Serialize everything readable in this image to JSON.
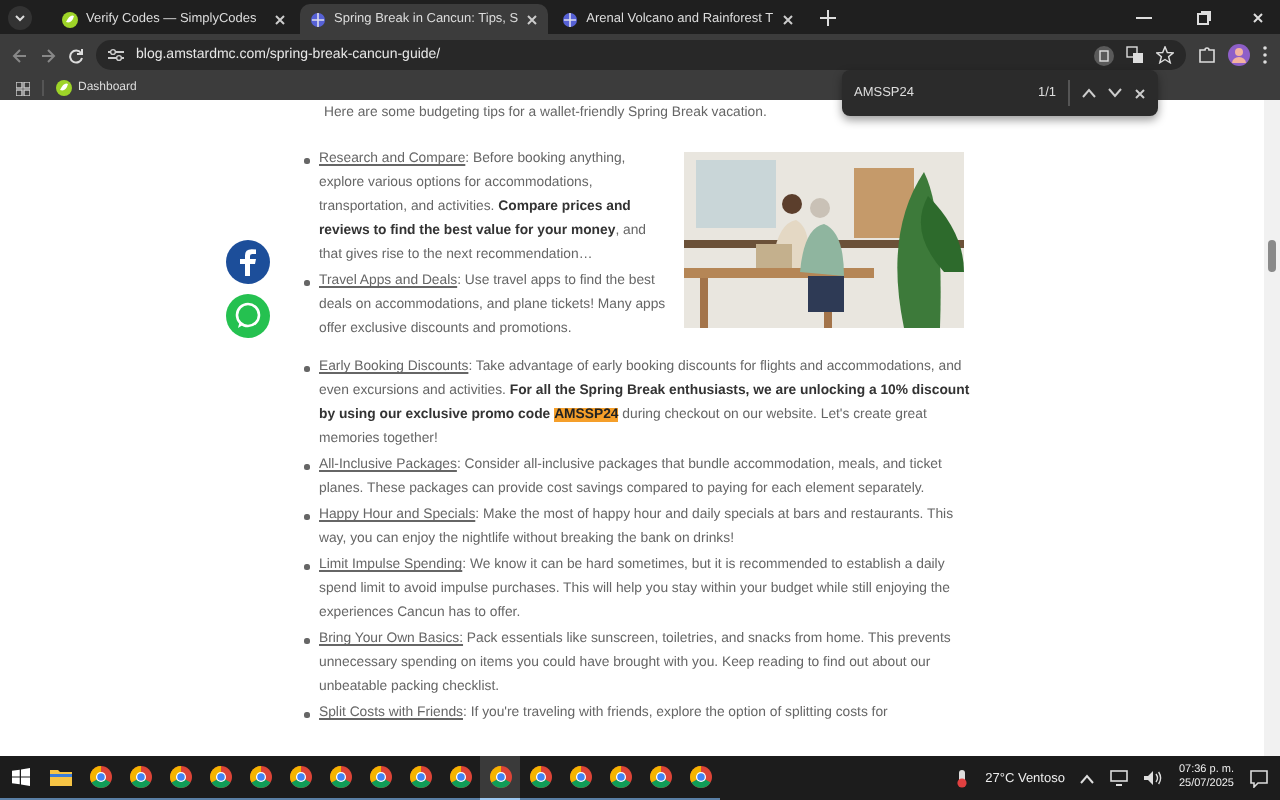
{
  "browser": {
    "tabs": [
      {
        "title": "Verify Codes — SimplyCodes",
        "selected": false
      },
      {
        "title": "Spring Break in Cancun: Tips, S",
        "selected": true
      },
      {
        "title": "Arenal Volcano and Rainforest T",
        "selected": false
      }
    ],
    "address": "blog.amstardmc.com/spring-break-cancun-guide/",
    "bookmarks": [
      {
        "label": "Dashboard"
      }
    ],
    "find_bar": {
      "query": "AMSSP24",
      "count": "1/1"
    }
  },
  "article": {
    "intro": "Here are some budgeting tips for a wallet-friendly Spring Break vacation.",
    "top_items": [
      {
        "link": "Research and Compare",
        "text": ": Before booking anything, explore various options for accommodations, transportation, and activities. **Compare prices and reviews to find the best value for your money**, and that gives rise to the next recommendation…"
      },
      {
        "link": "Travel Apps and Deals",
        "text": ": Use travel apps to find the best deals on accommodations, and plane tickets! Many apps offer exclusive discounts and promotions."
      }
    ],
    "items": [
      {
        "link": "Early Booking Discounts",
        "text": ": Take advantage of early booking discounts for flights and accommodations, and even excursions and activities. **For all the Spring Break enthusiasts, we are unlocking a 10% discount by using our exclusive promo code** ",
        "highlight": "AMSSP24",
        "text_after": " during checkout on our website. Let's create great memories together!"
      },
      {
        "link": "All-Inclusive Packages",
        "text": ": Consider all-inclusive packages that bundle accommodation, meals, and ticket planes. These packages can provide cost savings compared to paying for each element separately."
      },
      {
        "link": "Happy Hour and Specials",
        "text": ": Make the most of happy hour and daily specials at bars and restaurants. This way, you can enjoy the nightlife without breaking the bank on drinks!"
      },
      {
        "link": "Limit Impulse Spending",
        "text": ": We know it can be hard sometimes, but it is recommended to establish a daily spend limit to avoid impulse purchases. This will help you stay within your budget while still enjoying the experiences Cancun has to offer."
      },
      {
        "link": "Bring Your Own Basics:",
        "text": " Pack essentials like sunscreen, toiletries, and snacks from home. This prevents unnecessary spending on items you could have brought with you. Keep reading to find out about our unbeatable packing checklist."
      },
      {
        "link": "Split Costs with Friends",
        "text": ": If you're traveling with friends, explore the option of splitting costs for"
      }
    ]
  },
  "taskbar": {
    "apps": [
      {
        "kind": "start",
        "selected": false
      },
      {
        "kind": "explorer",
        "selected": false
      },
      {
        "kind": "chrome",
        "selected": false
      },
      {
        "kind": "chrome",
        "selected": false
      },
      {
        "kind": "chrome",
        "selected": false
      },
      {
        "kind": "chrome",
        "selected": false
      },
      {
        "kind": "chrome",
        "selected": false
      },
      {
        "kind": "chrome",
        "selected": false
      },
      {
        "kind": "chrome",
        "selected": false
      },
      {
        "kind": "chrome",
        "selected": false
      },
      {
        "kind": "chrome",
        "selected": false
      },
      {
        "kind": "chrome",
        "selected": false
      },
      {
        "kind": "chrome",
        "selected": true
      },
      {
        "kind": "chrome",
        "selected": false
      },
      {
        "kind": "chrome",
        "selected": false
      },
      {
        "kind": "chrome",
        "selected": false
      },
      {
        "kind": "chrome",
        "selected": false
      },
      {
        "kind": "chrome",
        "selected": false
      }
    ],
    "weather": "27°C Ventoso",
    "time": "07:36 p. m.",
    "date": "25/07/2025"
  }
}
